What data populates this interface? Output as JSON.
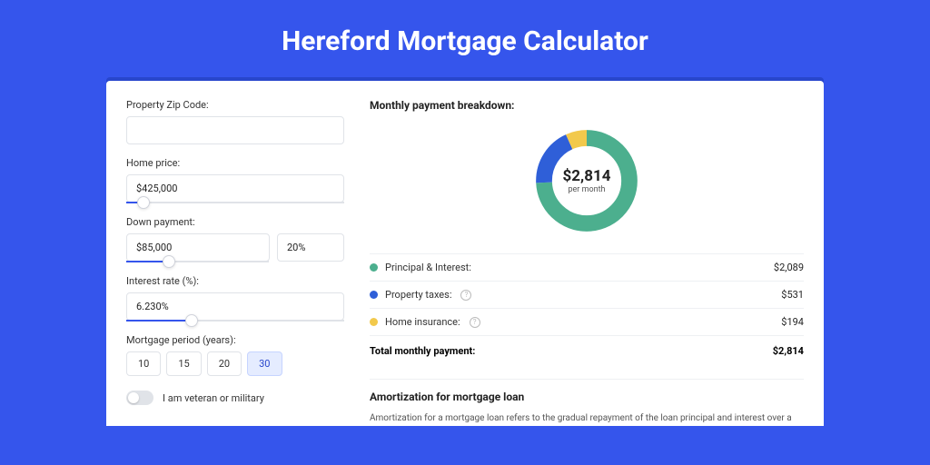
{
  "page_title": "Hereford Mortgage Calculator",
  "form": {
    "zip": {
      "label": "Property Zip Code:",
      "value": ""
    },
    "home_price": {
      "label": "Home price:",
      "value": "$425,000",
      "slider_pct": 8
    },
    "down_payment": {
      "label": "Down payment:",
      "value": "$85,000",
      "pct": "20%",
      "slider_pct": 20
    },
    "interest": {
      "label": "Interest rate (%):",
      "value": "6.230%",
      "slider_pct": 30
    },
    "period": {
      "label": "Mortgage period (years):",
      "options": [
        "10",
        "15",
        "20",
        "30"
      ],
      "selected": "30"
    },
    "veteran": {
      "label": "I am veteran or military",
      "checked": false
    }
  },
  "breakdown": {
    "title": "Monthly payment breakdown:",
    "center_value": "$2,814",
    "center_sub": "per month",
    "rows": [
      {
        "color": "g",
        "label": "Principal & Interest:",
        "info": false,
        "value": "$2,089"
      },
      {
        "color": "b",
        "label": "Property taxes:",
        "info": true,
        "value": "$531"
      },
      {
        "color": "y",
        "label": "Home insurance:",
        "info": true,
        "value": "$194"
      }
    ],
    "total": {
      "label": "Total monthly payment:",
      "value": "$2,814"
    }
  },
  "amort": {
    "title": "Amortization for mortgage loan",
    "body": "Amortization for a mortgage loan refers to the gradual repayment of the loan principal and interest over a specified"
  },
  "chart_data": {
    "type": "pie",
    "title": "Monthly payment breakdown",
    "series": [
      {
        "name": "Principal & Interest",
        "value": 2089,
        "color": "#4caf8e"
      },
      {
        "name": "Property taxes",
        "value": 531,
        "color": "#2f5fd8"
      },
      {
        "name": "Home insurance",
        "value": 194,
        "color": "#f2c94c"
      }
    ],
    "total": 2814
  }
}
